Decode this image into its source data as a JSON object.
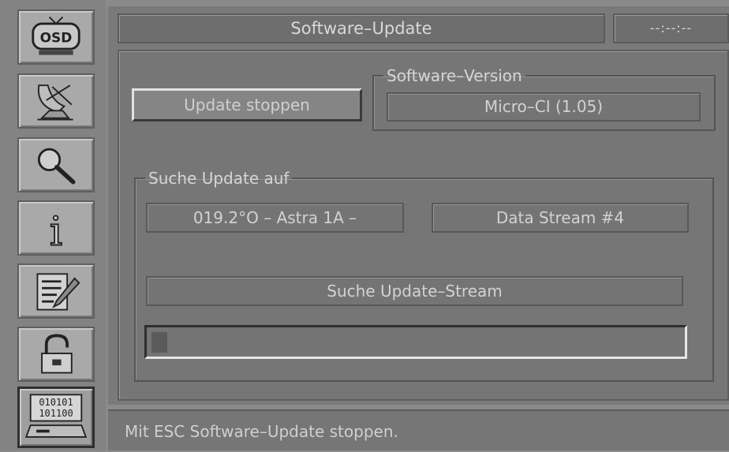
{
  "sidebar": {
    "items": [
      {
        "icon": "osd-tv-icon",
        "label": "OSD"
      },
      {
        "icon": "satellite-dish-icon"
      },
      {
        "icon": "search-magnifier-icon"
      },
      {
        "icon": "info-icon",
        "label": "i"
      },
      {
        "icon": "edit-document-icon"
      },
      {
        "icon": "parental-lock-icon"
      },
      {
        "icon": "binary-receiver-icon",
        "active": true,
        "label_top": "010101",
        "label_bottom": "101100"
      }
    ]
  },
  "header": {
    "title": "Software–Update",
    "clock": "--:--:--"
  },
  "actions": {
    "stop_update_label": "Update stoppen"
  },
  "software_version": {
    "legend": "Software–Version",
    "value": "Micro–CI  (1.05)"
  },
  "search": {
    "legend": "Suche Update auf",
    "satellite": "019.2°O – Astra 1A –",
    "stream": "Data Stream #4",
    "status": "Suche Update–Stream",
    "progress_fraction": 0.03
  },
  "status_bar": {
    "message": "Mit ESC Software–Update stoppen."
  },
  "colors": {
    "background": "#7a7a7a",
    "text": "#d8d8d8",
    "progress_fill": "#5a5a5a"
  }
}
